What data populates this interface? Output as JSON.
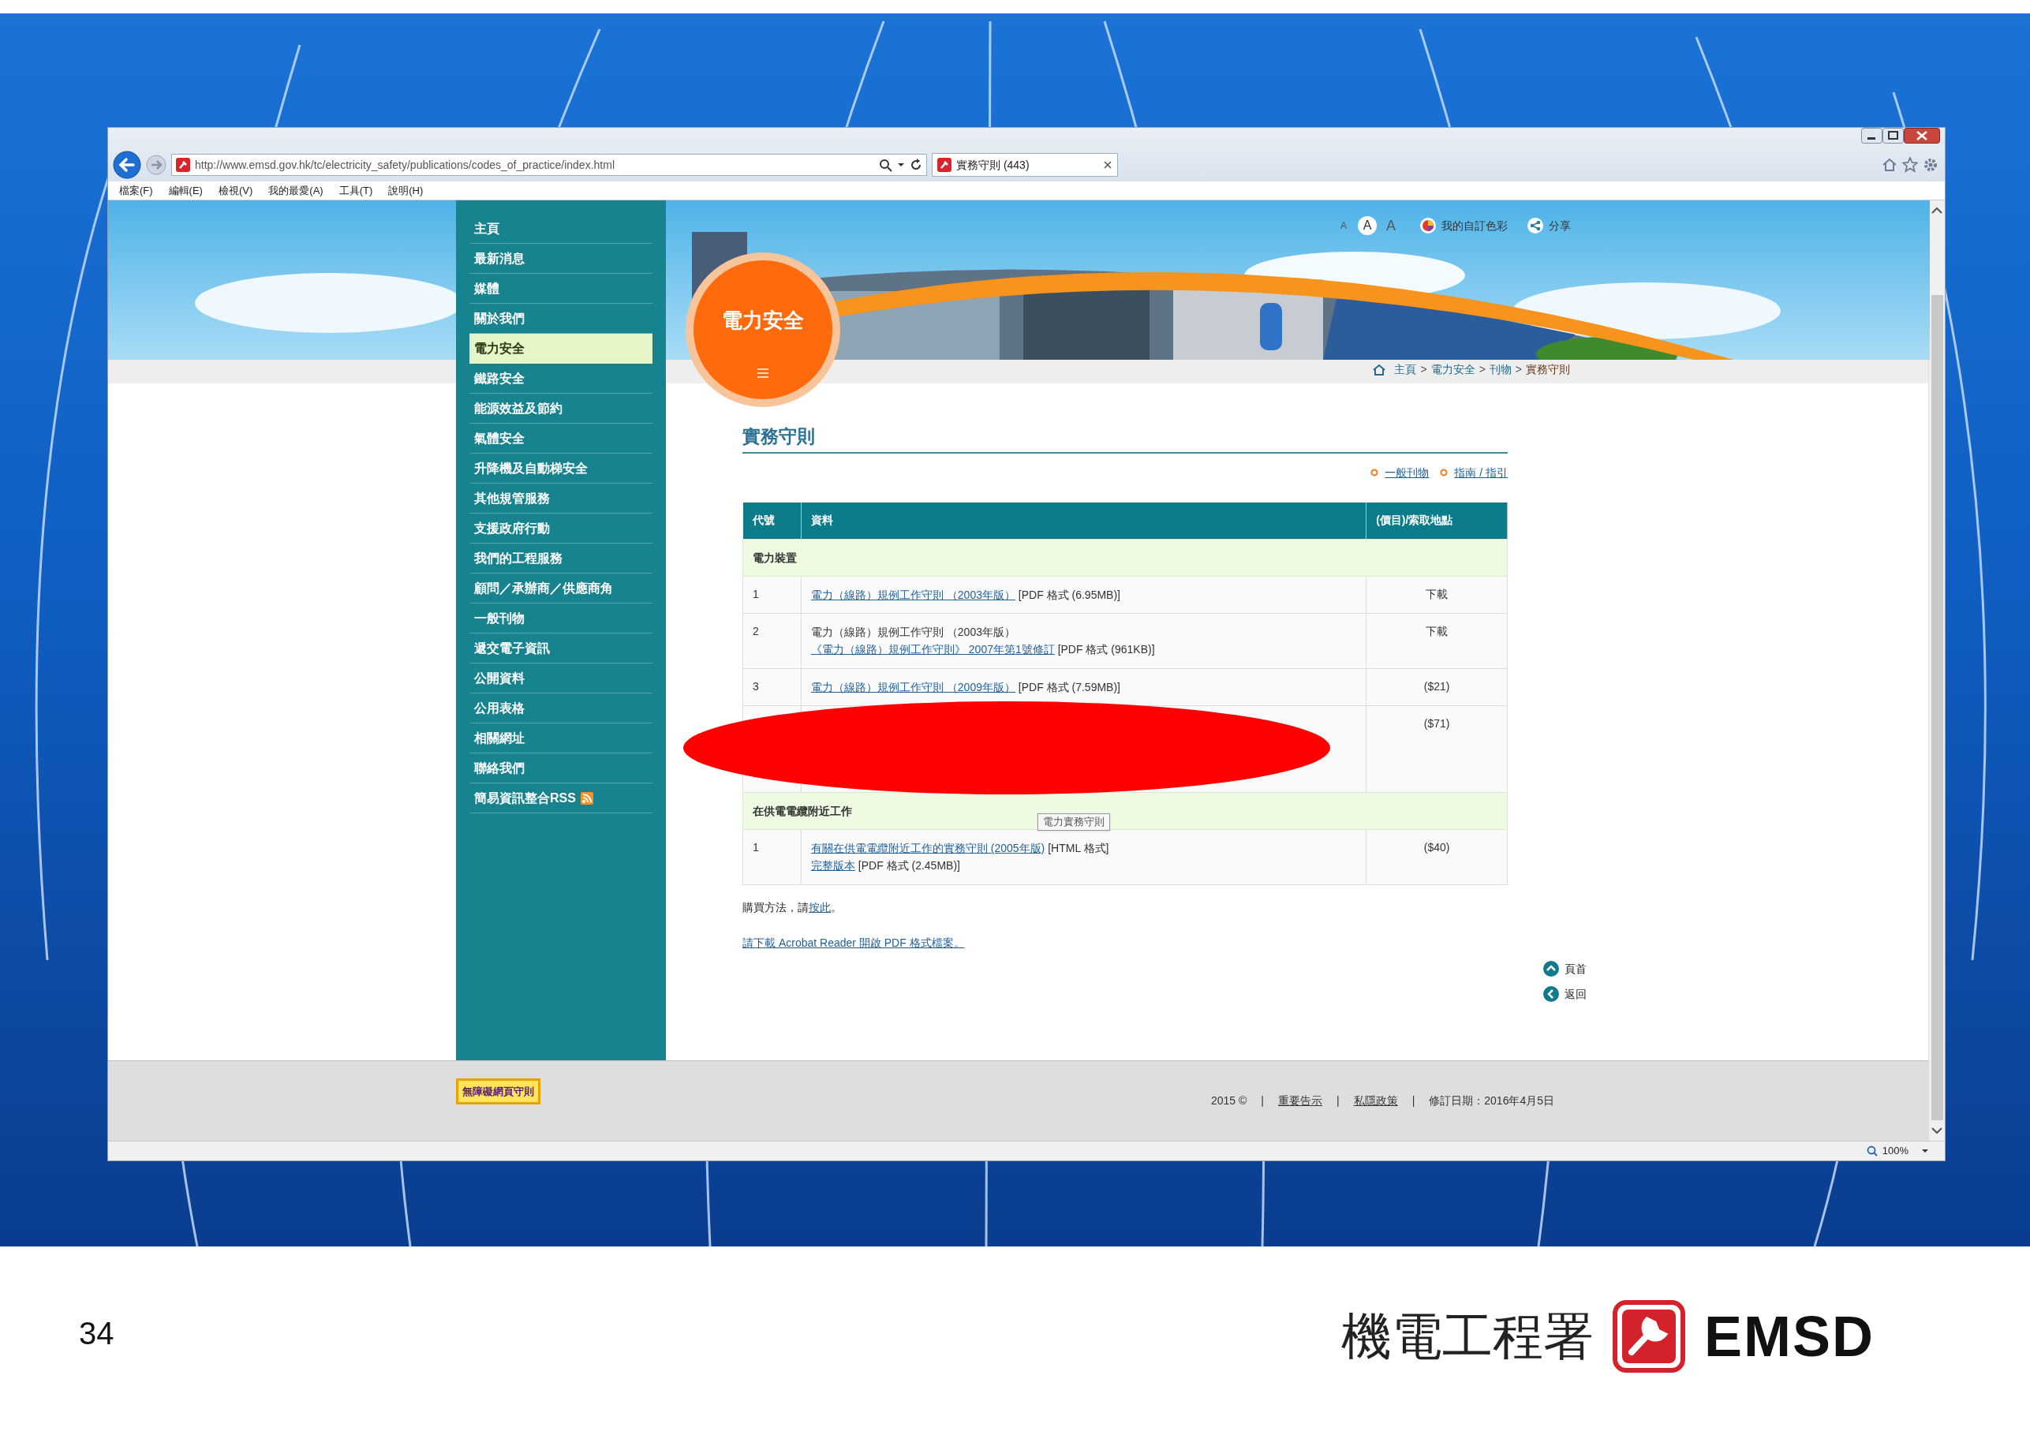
{
  "browser": {
    "address": "http://www.emsd.gov.hk/tc/electricity_safety/publications/codes_of_practice/index.html",
    "tab": {
      "title": "實務守則 (443)"
    },
    "menu": [
      "檔案(F)",
      "編輯(E)",
      "檢視(V)",
      "我的最愛(A)",
      "工具(T)",
      "說明(H)"
    ],
    "zoom": "100%"
  },
  "page": {
    "font_sizes": [
      {
        "label": "A",
        "selected": false
      },
      {
        "label": "A",
        "selected": true
      },
      {
        "label": "A",
        "selected": false
      }
    ],
    "tools": [
      {
        "kind": "colors",
        "label": "我的自訂色彩"
      },
      {
        "kind": "share",
        "label": "分享"
      }
    ],
    "section_badge": "電力安全",
    "breadcrumb": {
      "separator": ">",
      "items": [
        "主頁",
        "電力安全",
        "刊物",
        "實務守則"
      ]
    },
    "sidebar": [
      {
        "label": "主頁",
        "selected": false
      },
      {
        "label": "最新消息",
        "selected": false
      },
      {
        "label": "媒體",
        "selected": false
      },
      {
        "label": "關於我們",
        "selected": false
      },
      {
        "label": "電力安全",
        "selected": true
      },
      {
        "label": "鐵路安全",
        "selected": false
      },
      {
        "label": "能源效益及節約",
        "selected": false
      },
      {
        "label": "氣體安全",
        "selected": false
      },
      {
        "label": "升降機及自動梯安全",
        "selected": false
      },
      {
        "label": "其他規管服務",
        "selected": false
      },
      {
        "label": "支援政府行動",
        "selected": false
      },
      {
        "label": "我們的工程服務",
        "selected": false
      },
      {
        "label": "顧問／承辦商／供應商角",
        "selected": false
      },
      {
        "label": "一般刊物",
        "selected": false
      },
      {
        "label": "遞交電子資訊",
        "selected": false
      },
      {
        "label": "公開資料",
        "selected": false
      },
      {
        "label": "公用表格",
        "selected": false
      },
      {
        "label": "相關網址",
        "selected": false
      },
      {
        "label": "聯絡我們",
        "selected": false
      },
      {
        "label": "簡易資訊整合RSS",
        "selected": false,
        "rss": true
      }
    ],
    "heading": "實務守則",
    "quick_links": [
      "一般刊物",
      "指南 / 指引"
    ],
    "table": {
      "columns": [
        "代號",
        "資料",
        "(價目)/索取地點"
      ],
      "sections": [
        {
          "title": "電力裝置",
          "rows": [
            {
              "code": "1",
              "lines": [
                [
                  {
                    "text": "電力（線路）規例工作守則 （2003年版）",
                    "link": true
                  },
                  {
                    "text": " [PDF 格式 (6.95MB)]",
                    "link": false
                  }
                ]
              ],
              "price": "下載"
            },
            {
              "code": "2",
              "lines": [
                [
                  {
                    "text": "電力（線路）規例工作守則 （2003年版）",
                    "link": false
                  }
                ],
                [
                  {
                    "text": "《電力（線路）規例工作守則》 2007年第1號修訂",
                    "link": true
                  },
                  {
                    "text": " [PDF 格式 (961KB)]",
                    "link": false
                  }
                ]
              ],
              "price": "下載"
            },
            {
              "code": "3",
              "lines": [
                [
                  {
                    "text": "電力（線路）規例工作守則 （2009年版）",
                    "link": true
                  },
                  {
                    "text": " [PDF 格式 (7.59MB)]",
                    "link": false
                  }
                ]
              ],
              "price": "($21)"
            },
            {
              "redacted": true,
              "price": "($71)"
            }
          ]
        },
        {
          "title": "在供電電纜附近工作",
          "tooltip": "電力實務守則",
          "rows": [
            {
              "code": "1",
              "lines": [
                [
                  {
                    "text": "有關在供電電纜附近工作的實務守則 (2005年版)",
                    "link": true
                  },
                  {
                    "text": " [HTML 格式]",
                    "link": false
                  }
                ],
                [
                  {
                    "text": "完整版本",
                    "link": true
                  },
                  {
                    "text": " [PDF 格式 (2.45MB)]",
                    "link": false
                  }
                ]
              ],
              "price": "($40)"
            }
          ]
        }
      ]
    },
    "purchase_note": [
      {
        "text": "購買方法，請",
        "link": false
      },
      {
        "text": "按此",
        "link": true
      },
      {
        "text": "。",
        "link": false
      }
    ],
    "acrobat_link": "請下載 Acrobat Reader 開啟 PDF 格式檔案。",
    "page_nav": [
      {
        "kind": "top",
        "label": "頁首"
      },
      {
        "kind": "back",
        "label": "返回"
      }
    ],
    "footer": {
      "accessibility_badge": "無障礙網頁守則",
      "year": "2015 ©",
      "separator": "|",
      "links": [
        "重要告示",
        "私隱政策"
      ],
      "revised": "修訂日期：2016年4月5日"
    }
  },
  "slide": {
    "page_number": "34",
    "logo_zh": "機電工程署",
    "logo_en": "EMSD"
  }
}
